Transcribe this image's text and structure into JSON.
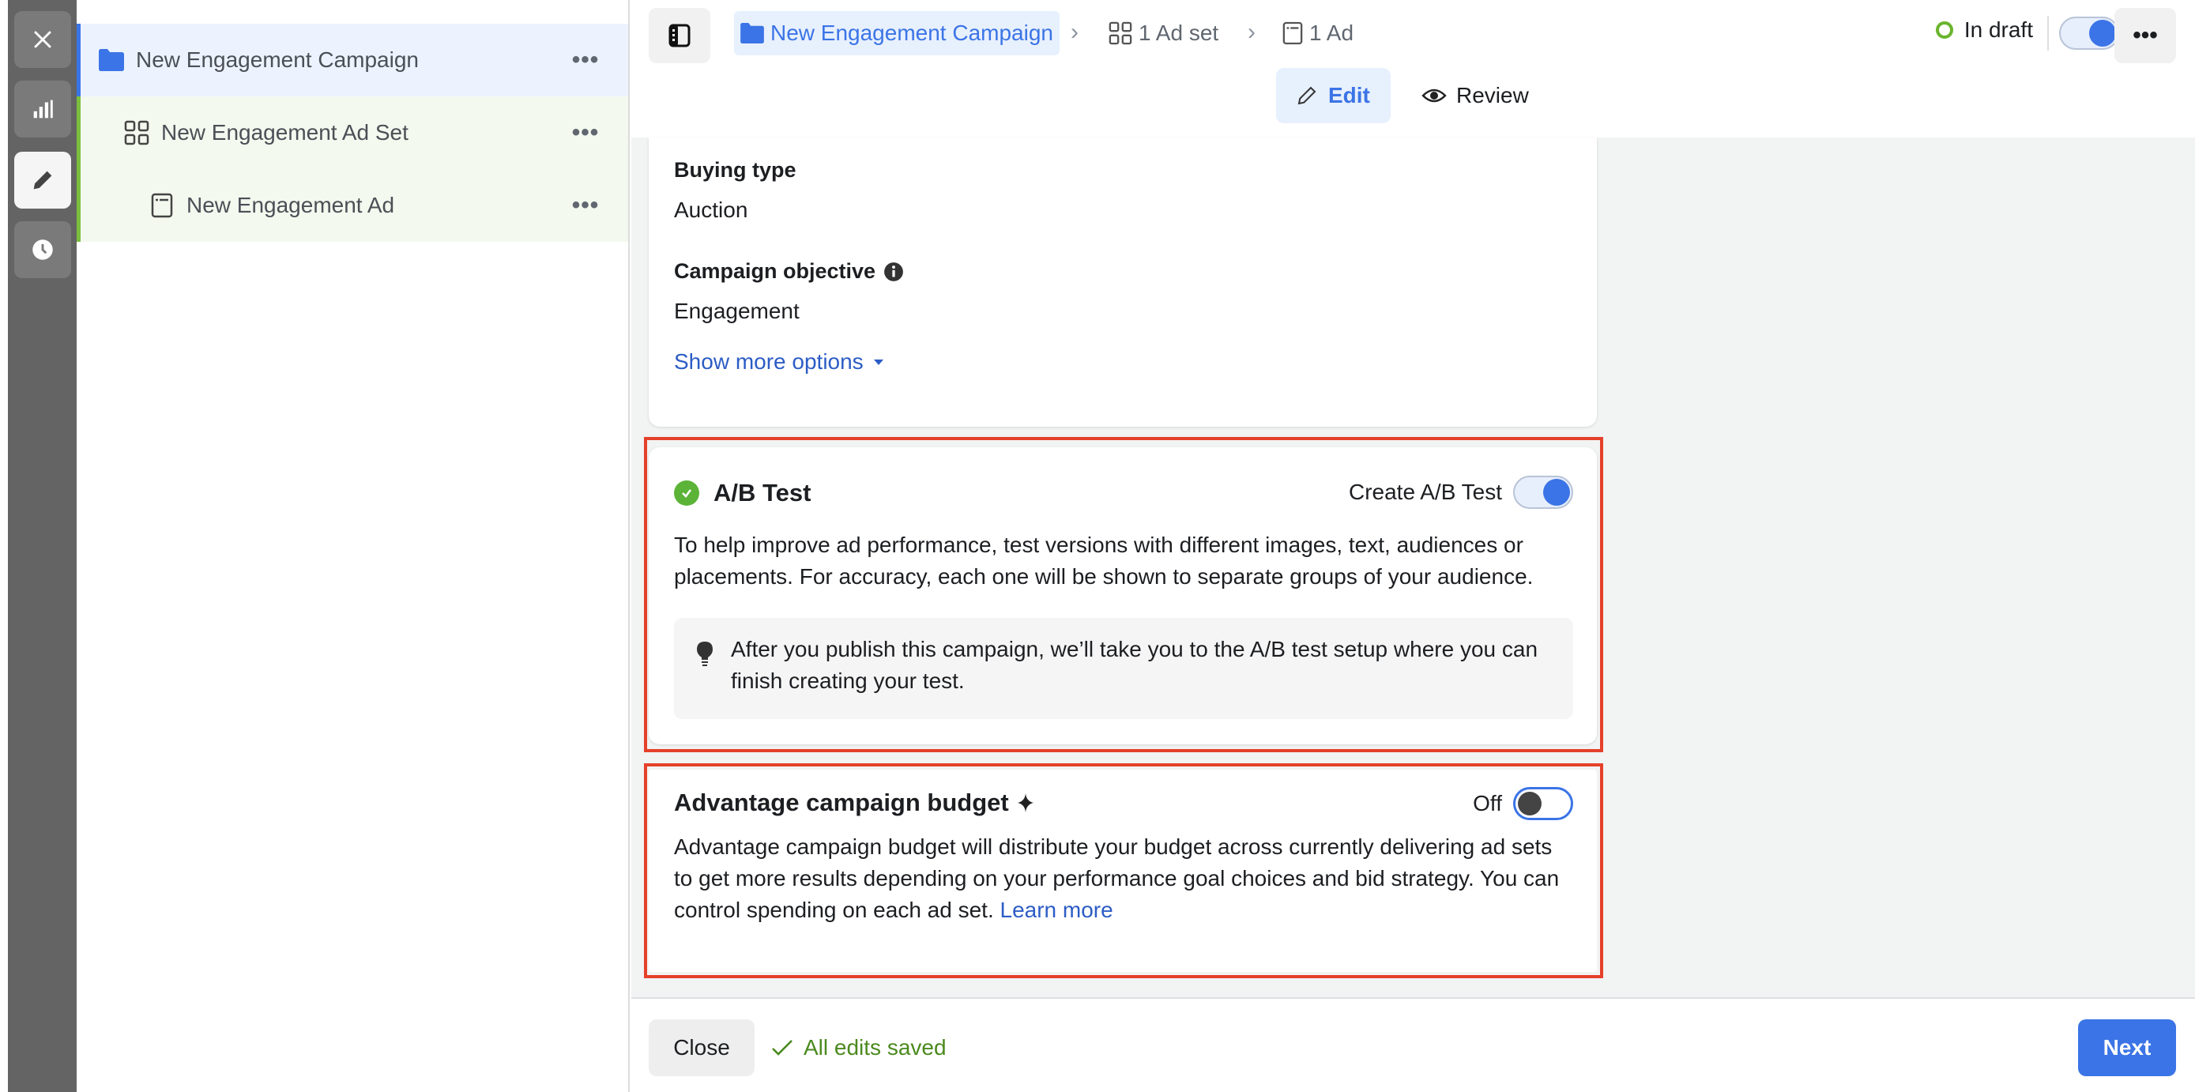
{
  "rail": {
    "items": [
      {
        "icon": "close-icon",
        "active": false
      },
      {
        "icon": "bar-chart-icon",
        "active": false
      },
      {
        "icon": "pencil-icon",
        "active": true
      },
      {
        "icon": "clock-icon",
        "active": false
      }
    ]
  },
  "tree": {
    "items": [
      {
        "label": "New Engagement Campaign",
        "icon": "folder-icon",
        "more": "•••"
      },
      {
        "label": "New Engagement Ad Set",
        "icon": "grid-icon",
        "more": "•••"
      },
      {
        "label": "New Engagement Ad",
        "icon": "ad-icon",
        "more": "•••"
      }
    ]
  },
  "header": {
    "breadcrumb": [
      {
        "label": "New Engagement Campaign",
        "icon": "folder-icon"
      },
      {
        "label": "1 Ad set",
        "icon": "grid-icon"
      },
      {
        "label": "1 Ad",
        "icon": "ad-icon"
      }
    ],
    "chevron": "›",
    "status": "In draft",
    "status_color": "#6ab42d",
    "toggle_on": true,
    "more": "•••",
    "tabs": [
      {
        "label": "Edit",
        "active": true
      },
      {
        "label": "Review",
        "active": false
      }
    ]
  },
  "campaign_details": {
    "buying_type_label": "Buying type",
    "buying_type_value": "Auction",
    "objective_label": "Campaign objective",
    "objective_value": "Engagement",
    "show_more": "Show more options"
  },
  "ab_test": {
    "title": "A/B Test",
    "toggle_label": "Create A/B Test",
    "toggle_on": true,
    "description": "To help improve ad performance, test versions with different images, text, audiences or placements. For accuracy, each one will be shown to separate groups of your audience.",
    "tip": "After you publish this campaign, we’ll take you to the A/B test setup where you can finish creating your test."
  },
  "advantage_budget": {
    "title": "Advantage campaign budget",
    "toggle_label": "Off",
    "toggle_on": false,
    "description": "Advantage campaign budget will distribute your budget across currently delivering ad sets to get more results depending on your performance goal choices and bid strategy. You can control spending on each ad set.",
    "learn_more": "Learn more"
  },
  "footer": {
    "close_label": "Close",
    "saved_status": "All edits saved",
    "next_label": "Next"
  },
  "colors": {
    "accent": "#3b74e6",
    "highlight_border": "#e5402a",
    "success": "#5bb338"
  }
}
